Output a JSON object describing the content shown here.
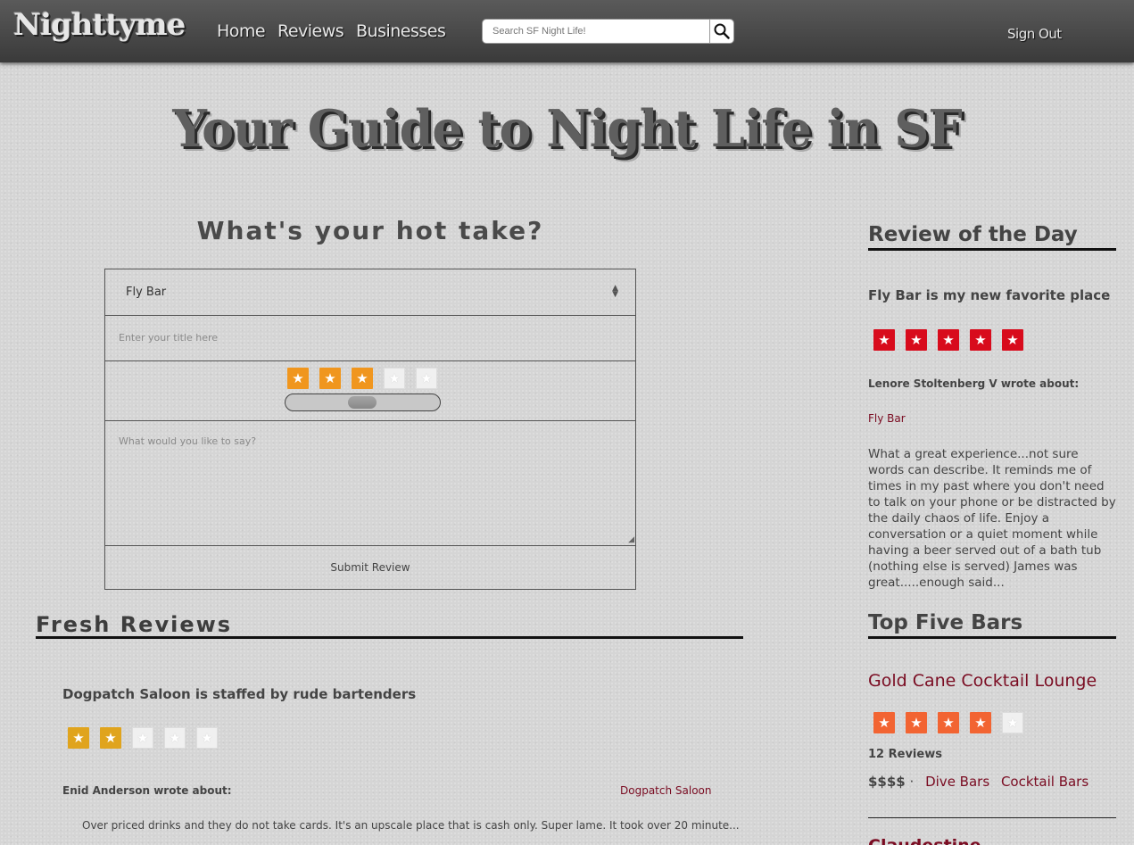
{
  "nav": {
    "logo": "Nighttyme",
    "links": [
      "Home",
      "Reviews",
      "Businesses"
    ],
    "search_placeholder": "Search SF Night Life!",
    "sign_out": "Sign Out"
  },
  "hero": {
    "title": "Your Guide to Night Life in SF"
  },
  "review_form": {
    "heading": "What's your hot take?",
    "business_selected": "Fly Bar",
    "title_placeholder": "Enter your title here",
    "rating": 3,
    "rating_max": 5,
    "body_placeholder": "What would you like to say?",
    "submit_label": "Submit Review"
  },
  "fresh_reviews": {
    "heading": "Fresh Reviews",
    "items": [
      {
        "title": "Dogpatch Saloon is staffed by rude bartenders",
        "rating": 2,
        "author_line": "Enid Anderson wrote about:",
        "business": "Dogpatch Saloon",
        "body": "Over priced drinks and they do not take cards. It's an upscale place that is cash only. Super lame. It took over 20 minute..."
      }
    ]
  },
  "review_of_day": {
    "heading": "Review of the Day",
    "title": "Fly Bar is my new favorite place",
    "rating": 5,
    "author_line": "Lenore Stoltenberg V wrote about:",
    "business": "Fly Bar",
    "body": "What a great experience...not sure words can describe. It reminds me of times in my past where you don't need to talk on your phone or be distracted by the daily chaos of life. Enjoy a conversation or a quiet moment while having a beer served out of a bath tub (nothing else is served) James was great.....enough said..."
  },
  "top_bars": {
    "heading": "Top Five Bars",
    "items": [
      {
        "name": "Gold Cane Cocktail Lounge",
        "rating": 4,
        "reviews": "12 Reviews",
        "price": "$$$$",
        "separator": "·",
        "categories": [
          "Dive Bars",
          "Cocktail Bars"
        ]
      }
    ],
    "next_partial": "Claudestine"
  },
  "colors": {
    "accent_link": "#7a0c22",
    "star_form": "#f0961e",
    "star_review_of_day": "#d80b1c",
    "star_top_bars": "#f26432",
    "star_fresh": "#e0a41d"
  }
}
